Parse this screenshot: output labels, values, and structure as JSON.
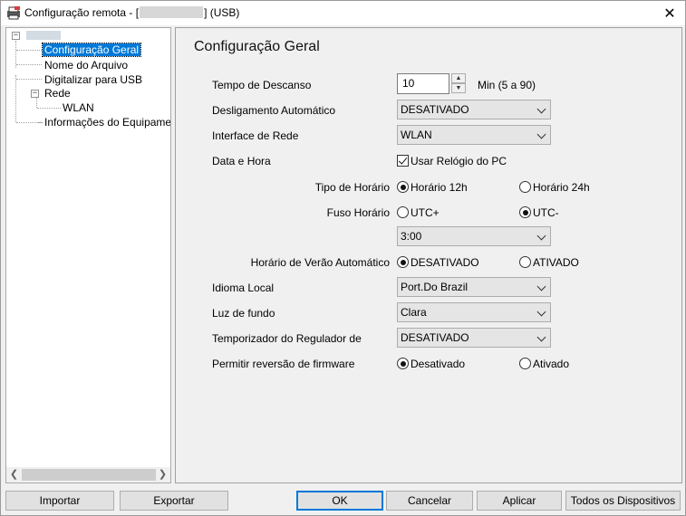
{
  "window": {
    "title_prefix": "Configuração remota - [",
    "title_suffix": "] (USB)",
    "close_glyph": "✕"
  },
  "tree": {
    "nodes": [
      {
        "label": "Configuração Geral",
        "selected": true
      },
      {
        "label": "Nome do Arquivo"
      },
      {
        "label": "Digitalizar para USB"
      },
      {
        "label": "Rede"
      },
      {
        "label": "WLAN"
      },
      {
        "label": "Informações do Equipamento"
      }
    ],
    "expander_minus": "−"
  },
  "content": {
    "title": "Configuração Geral",
    "sleep_time": {
      "label": "Tempo de Descanso",
      "value": "10",
      "unit": "Min (5 a 90)"
    },
    "auto_power_off": {
      "label": "Desligamento Automático",
      "value": "DESATIVADO"
    },
    "network_interface": {
      "label": "Interface de Rede",
      "value": "WLAN"
    },
    "date_time": {
      "label": "Data e Hora",
      "use_pc_clock_label": "Usar Relógio do PC",
      "use_pc_clock_checked": true
    },
    "clock_type": {
      "label": "Tipo de Horário",
      "option1": "Horário 12h",
      "option2": "Horário 24h",
      "selected": "Horário 12h"
    },
    "time_zone": {
      "label": "Fuso Horário",
      "option1": "UTC+",
      "option2": "UTC-",
      "selected": "UTC-",
      "offset": "3:00"
    },
    "auto_dst": {
      "label": "Horário de Verão Automático",
      "option1": "DESATIVADO",
      "option2": "ATIVADO",
      "selected": "DESATIVADO"
    },
    "local_language": {
      "label": "Idioma Local",
      "value": "Port.Do Brazil"
    },
    "backlight": {
      "label": "Luz de fundo",
      "value": "Clara"
    },
    "dimmer_timer": {
      "label": "Temporizador do Regulador de",
      "value": "DESATIVADO"
    },
    "firmware_rollback": {
      "label": "Permitir reversão de firmware",
      "option1": "Desativado",
      "option2": "Ativado",
      "selected": "Desativado"
    }
  },
  "buttons": {
    "import": "Importar",
    "export": "Exportar",
    "ok": "OK",
    "cancel": "Cancelar",
    "apply": "Aplicar",
    "all_devices": "Todos os Dispositivos"
  },
  "colors": {
    "selection": "#0078d7",
    "default_button_border": "#0078d7"
  }
}
